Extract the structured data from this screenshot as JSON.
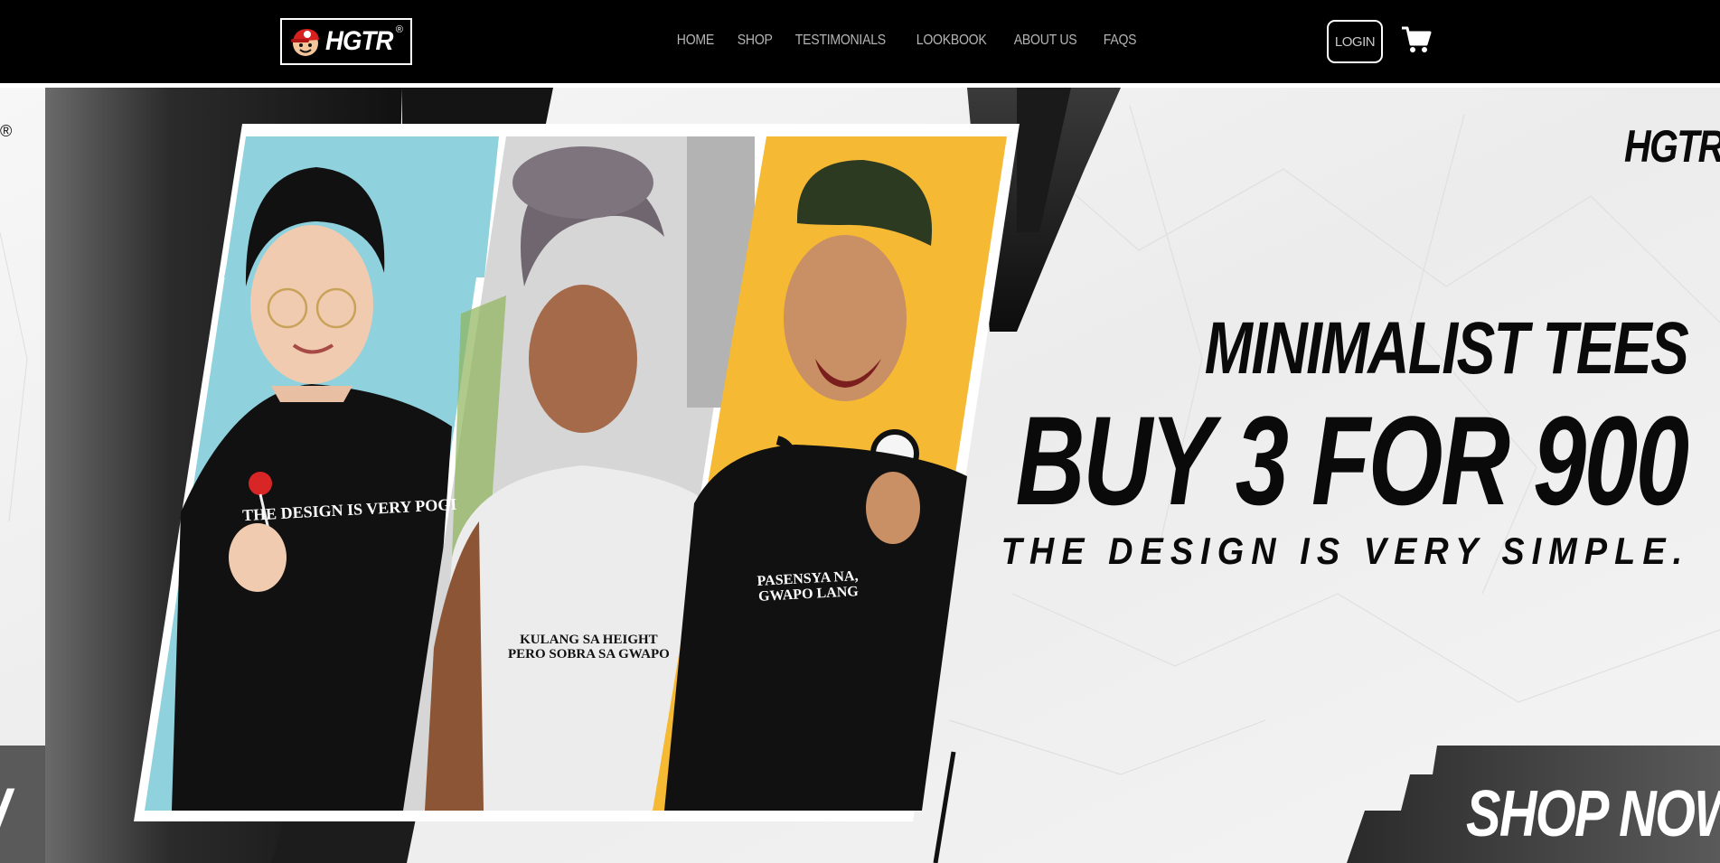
{
  "header": {
    "brand": "HGTR",
    "brand_mark": "®",
    "nav": [
      "HOME",
      "SHOP",
      "TESTIMONIALS",
      "LOOKBOOK",
      "ABOUT US",
      "FAQS"
    ],
    "login_label": "LOGIN",
    "cart_icon": "shopping-cart-icon"
  },
  "hero": {
    "brand": "HGTR",
    "reg_mark": "®",
    "headline_1": "MINIMALIST TEES",
    "headline_2": "BUY 3 FOR 900",
    "tagline": "THE DESIGN IS VERY SIMPLE.",
    "cta": "SHOP NOW",
    "cta_left_fragment": "/",
    "models": [
      {
        "shirt_text": "THE DESIGN IS VERY POGI",
        "shirt_color": "#111111",
        "bg_color": "#8fd2de"
      },
      {
        "shirt_text_line1": "KULANG SA HEIGHT",
        "shirt_text_line2": "PERO SOBRA SA GWAPO",
        "shirt_color": "#ececec",
        "bg_color": "#d8d8d8"
      },
      {
        "shirt_text_line1": "PASENSYA NA,",
        "shirt_text_line2": "GWAPO LANG",
        "shirt_color": "#111111",
        "bg_color": "#f5b933"
      }
    ]
  },
  "colors": {
    "nav_bg": "#000000",
    "nav_text": "#b4b4b4",
    "hero_paper": "#f0f0f0",
    "hero_dark": "#1a1a1a"
  }
}
